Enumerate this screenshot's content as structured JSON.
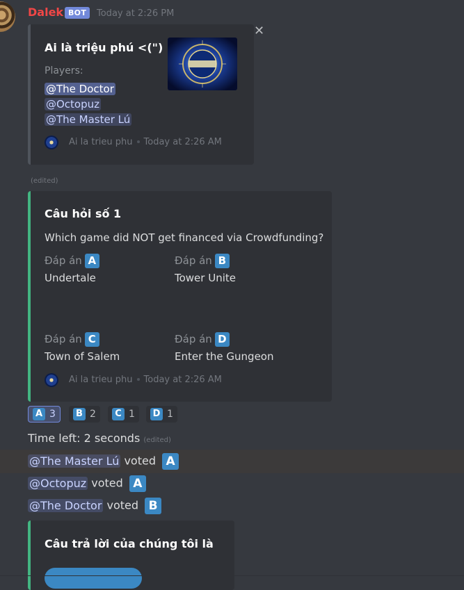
{
  "message": {
    "author": "Dalek",
    "bot_tag": "BOT",
    "timestamp": "Today at 2:26 PM"
  },
  "embed_players": {
    "title": "Ai là triệu phú <(\")",
    "players_label": "Players:",
    "players": [
      "@The Doctor",
      "@Octopuz",
      "@The Master Lú"
    ],
    "footer_text": "Ai la trieu phu",
    "footer_time": "Today at 2:26 AM"
  },
  "edited_label": "(edited)",
  "embed_question": {
    "title": "Câu hỏi số 1",
    "question": "Which game did NOT get financed via Crowdfunding?",
    "answer_label": "Đáp án",
    "answers": [
      {
        "letter": "A",
        "text": "Undertale"
      },
      {
        "letter": "B",
        "text": "Tower Unite"
      },
      {
        "letter": "C",
        "text": "Town of Salem"
      },
      {
        "letter": "D",
        "text": "Enter the Gungeon"
      }
    ],
    "footer_text": "Ai la trieu phu",
    "footer_time": "Today at 2:26 AM"
  },
  "reactions": [
    {
      "letter": "A",
      "count": "3"
    },
    {
      "letter": "B",
      "count": "2"
    },
    {
      "letter": "C",
      "count": "1"
    },
    {
      "letter": "D",
      "count": "1"
    }
  ],
  "time_left": "Time left: 2 seconds",
  "votes": [
    {
      "user": "@The Master Lú",
      "verb": "voted",
      "letter": "A"
    },
    {
      "user": "@Octopuz",
      "verb": "voted",
      "letter": "A"
    },
    {
      "user": "@The Doctor",
      "verb": "voted",
      "letter": "B"
    }
  ],
  "embed_answer": {
    "title": "Câu trả lời của chúng tôi là"
  },
  "icons": {
    "close": "close-icon",
    "footer": "ai-la-trieu-phu-logo-icon",
    "thumbnail": "who-wants-to-be-a-millionaire-logo"
  },
  "colors": {
    "author": "#f04747",
    "bot_tag": "#7289da",
    "embed_accent": "#43b581",
    "letter_badge": "#3b88c3",
    "mention": "#7289da"
  }
}
